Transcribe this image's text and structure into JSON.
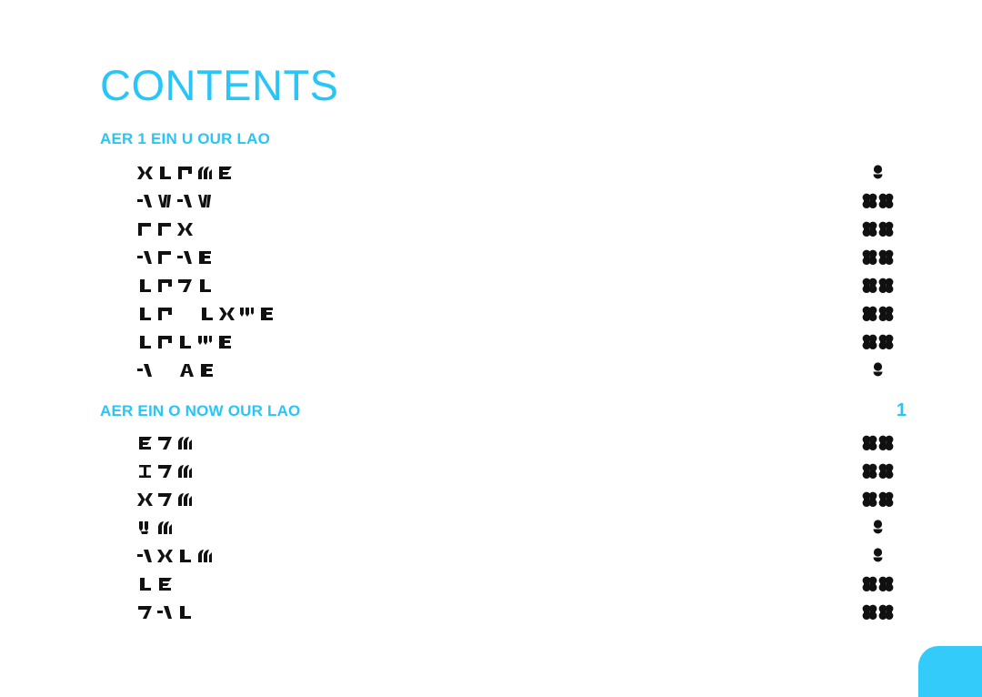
{
  "document": {
    "title": "CONTENTS",
    "background_color": "#ffffff",
    "accent_color": "#29C5F6",
    "corner_tab_color": "#33CCFA",
    "glyph_color": "#111111",
    "script_note": "body entries and page numbers rendered in a non-Latin fictional script"
  },
  "sections": [
    {
      "heading": "AER 1 EIN U OUR LAO",
      "heading_page": "",
      "entries": [
        {
          "label_glyphs": "X J G M E",
          "page_glyphs": "o"
        },
        {
          "label_glyphs": "7 W 7 W",
          "page_glyphs": "oo"
        },
        {
          "label_glyphs": "C C X",
          "page_glyphs": "oo"
        },
        {
          "label_glyphs": "7 C 7 E",
          "page_glyphs": "oo"
        },
        {
          "label_glyphs": "J G 7 J",
          "page_glyphs": "oo"
        },
        {
          "label_glyphs": "J G | J X W E",
          "page_glyphs": "oo"
        },
        {
          "label_glyphs": "J G J W E",
          "page_glyphs": "oo"
        },
        {
          "label_glyphs": "7 A E",
          "page_glyphs": "o"
        }
      ]
    },
    {
      "heading": "AER  EIN O NOW OUR LAO",
      "heading_page": "1",
      "entries": [
        {
          "label_glyphs": "E 7 M",
          "page_glyphs": "oo"
        },
        {
          "label_glyphs": "I 7 M",
          "page_glyphs": "oo"
        },
        {
          "label_glyphs": "X 7 M",
          "page_glyphs": "oo"
        },
        {
          "label_glyphs": "V M",
          "page_glyphs": "o"
        },
        {
          "label_glyphs": "7 X J M",
          "page_glyphs": "o"
        },
        {
          "label_glyphs": "J E",
          "page_glyphs": "oo"
        },
        {
          "label_glyphs": "7 7 J",
          "page_glyphs": "oo"
        }
      ]
    }
  ]
}
